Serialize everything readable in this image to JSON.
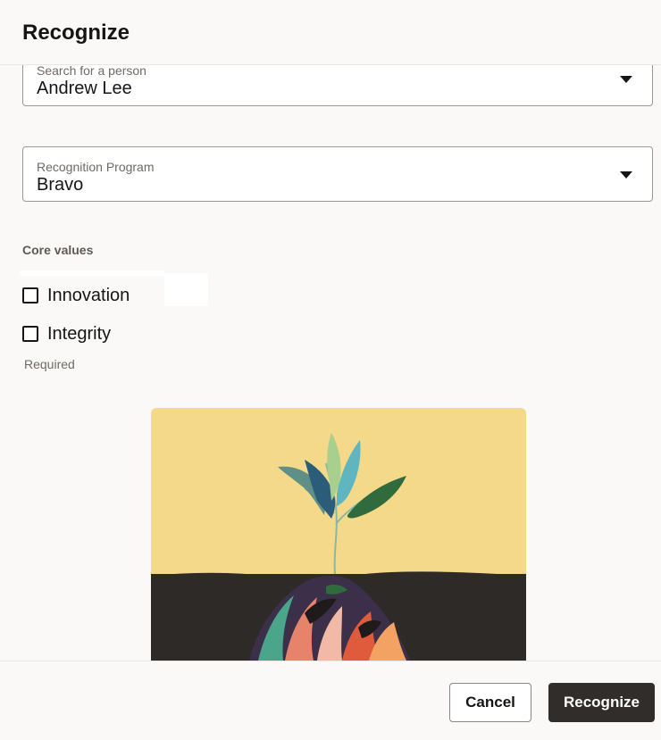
{
  "dialog": {
    "title": "Recognize"
  },
  "person_field": {
    "label": "Search for a person",
    "value": "Andrew Lee"
  },
  "program_field": {
    "label": "Recognition Program",
    "value": "Bravo"
  },
  "core_values": {
    "label": "Core values",
    "options": [
      {
        "label": "Innovation",
        "checked": false
      },
      {
        "label": "Integrity",
        "checked": false
      }
    ],
    "helper": "Required"
  },
  "illustration": {
    "icon": "growing-plant-illustration"
  },
  "footer": {
    "cancel_label": "Cancel",
    "submit_label": "Recognize"
  },
  "colors": {
    "primary_button": "#312d2a",
    "background": "#fbf9f8",
    "art_sky": "#f5d98a",
    "art_soil": "#2e2a27"
  }
}
